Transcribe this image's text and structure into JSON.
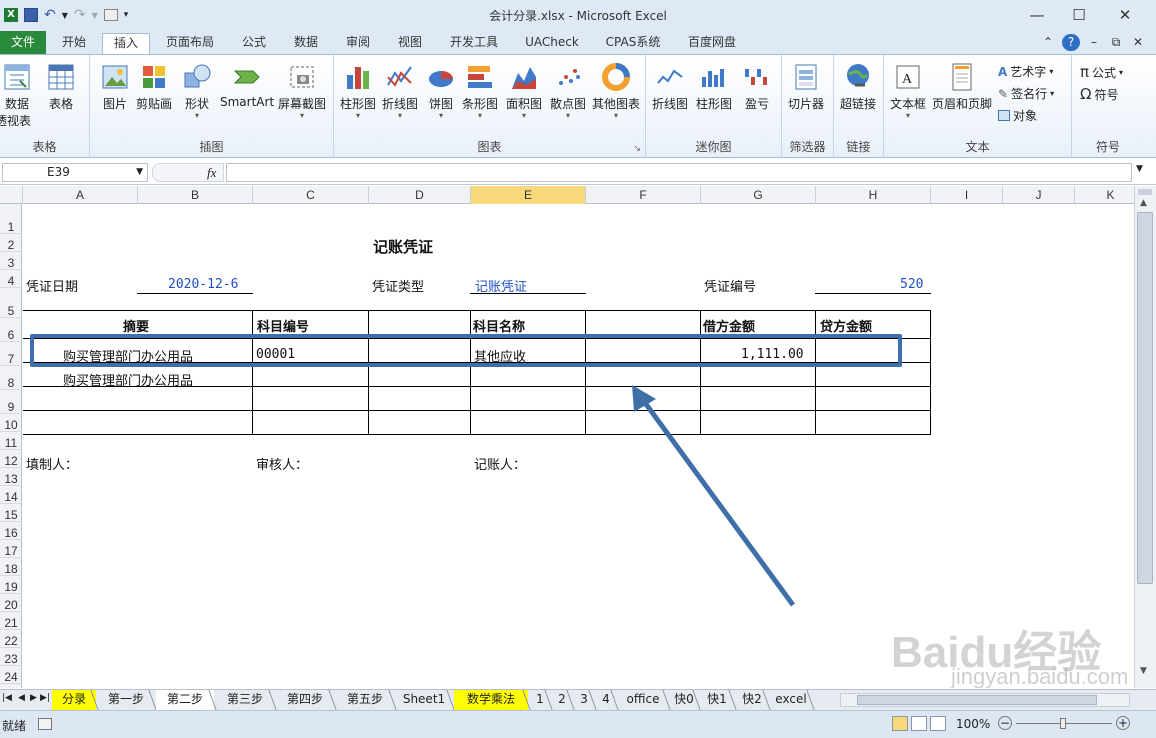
{
  "window": {
    "title": "会计分录.xlsx - Microsoft Excel"
  },
  "menu": {
    "tabs": [
      "文件",
      "开始",
      "插入",
      "页面布局",
      "公式",
      "数据",
      "审阅",
      "视图",
      "开发工具",
      "UACheck",
      "CPAS系统",
      "百度网盘"
    ]
  },
  "ribbon": {
    "tables": {
      "label": "表格",
      "btn1": "数据",
      "btn1b": "透视表",
      "btn2": "表格"
    },
    "illus": {
      "label": "插图",
      "btn1": "图片",
      "btn2": "剪贴画",
      "btn3": "形状",
      "btn4": "SmartArt",
      "btn5": "屏幕截图"
    },
    "charts": {
      "label": "图表",
      "btn1": "柱形图",
      "btn2": "折线图",
      "btn3": "饼图",
      "btn4": "条形图",
      "btn5": "面积图",
      "btn6": "散点图",
      "btn7": "其他图表"
    },
    "spark": {
      "label": "迷你图",
      "btn1": "折线图",
      "btn2": "柱形图",
      "btn3": "盈亏"
    },
    "filter": {
      "label": "筛选器",
      "btn1": "切片器"
    },
    "link": {
      "label": "链接",
      "btn1": "超链接"
    },
    "text": {
      "label": "文本",
      "btn1": "文本框",
      "btn2": "页眉和页脚",
      "s1": "艺术字",
      "s2": "签名行",
      "s3": "对象"
    },
    "symbol": {
      "label": "符号",
      "s1": "公式",
      "s2": "符号"
    }
  },
  "formula_bar": {
    "name_box": "E39",
    "fx": "fx",
    "content": ""
  },
  "columns": [
    "A",
    "B",
    "C",
    "D",
    "E",
    "F",
    "G",
    "H",
    "I",
    "J",
    "K"
  ],
  "selected_column": "E",
  "rows": [
    "1",
    "2",
    "3",
    "4",
    "5",
    "6",
    "7",
    "8",
    "9",
    "10",
    "11",
    "12",
    "13",
    "14",
    "15",
    "16",
    "17",
    "18",
    "19",
    "20",
    "21",
    "22",
    "23",
    "24"
  ],
  "sheet": {
    "title": "记账凭证",
    "date_label": "凭证日期",
    "date_value": "2020-12-6",
    "type_label": "凭证类型",
    "type_value": "记账凭证",
    "num_label": "凭证编号",
    "num_value": "520",
    "headers": {
      "summary": "摘要",
      "acct_code": "科目编号",
      "acct_name": "科目名称",
      "debit": "借方金额",
      "credit": "贷方金额"
    },
    "row6": {
      "summary": "购买管理部门办公用品",
      "acct_code": "00001",
      "acct_name": "其他应收",
      "debit": "1,111.00"
    },
    "row7": {
      "summary": "购买管理部门办公用品"
    },
    "maker": "填制人：",
    "reviewer": "审核人：",
    "bookkeeper": "记账人："
  },
  "sheet_tabs": [
    "分录",
    "第一步",
    "第二步",
    "第三步",
    "第四步",
    "第五步",
    "Sheet1",
    "数学乘法",
    "1",
    "2",
    "3",
    "4",
    "office",
    "快0",
    "快1",
    "快2",
    "excel"
  ],
  "active_sheet": "第二步",
  "yellow_sheets": [
    "分录",
    "数学乘法"
  ],
  "status": {
    "ready": "就绪",
    "zoom": "100%"
  },
  "watermark": {
    "main": "Baidu经验",
    "url": "jingyan.baidu.com"
  },
  "colors": {
    "annotation": "#3f6fa8",
    "file_tab": "#2a8a3c",
    "selected_header": "#f7d979",
    "blue_text": "#1f4fc4"
  }
}
